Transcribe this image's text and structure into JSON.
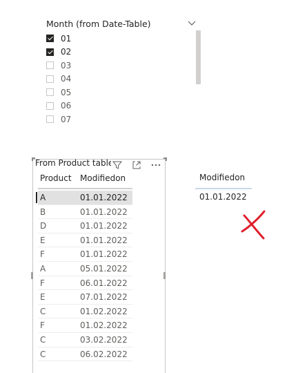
{
  "slicer": {
    "title": "Month (from Date-Table)",
    "items": [
      {
        "label": "01",
        "checked": true
      },
      {
        "label": "02",
        "checked": true
      },
      {
        "label": "03",
        "checked": false
      },
      {
        "label": "04",
        "checked": false
      },
      {
        "label": "05",
        "checked": false
      },
      {
        "label": "06",
        "checked": false
      },
      {
        "label": "07",
        "checked": false
      }
    ]
  },
  "table": {
    "title": "From Product table",
    "columns": [
      "Product",
      "Modifiedon"
    ],
    "rows": [
      [
        "A",
        "01.01.2022"
      ],
      [
        "B",
        "01.01.2022"
      ],
      [
        "D",
        "01.01.2022"
      ],
      [
        "E",
        "01.01.2022"
      ],
      [
        "F",
        "01.01.2022"
      ],
      [
        "A",
        "05.01.2022"
      ],
      [
        "F",
        "06.01.2022"
      ],
      [
        "E",
        "07.01.2022"
      ],
      [
        "C",
        "01.02.2022"
      ],
      [
        "F",
        "01.02.2022"
      ],
      [
        "C",
        "03.02.2022"
      ],
      [
        "C",
        "06.02.2022"
      ]
    ]
  },
  "card": {
    "header": "Modifiedon",
    "value": "01.01.2022"
  },
  "colors": {
    "text": "#252423",
    "muted": "#605e5c",
    "selected_row": "#e1e1e1",
    "annotation_red": "#e01e2a"
  },
  "icons": {
    "dropdown": "chevron-down-icon",
    "filter": "filter-icon",
    "focus": "focus-mode-icon",
    "more": "more-options-icon"
  }
}
